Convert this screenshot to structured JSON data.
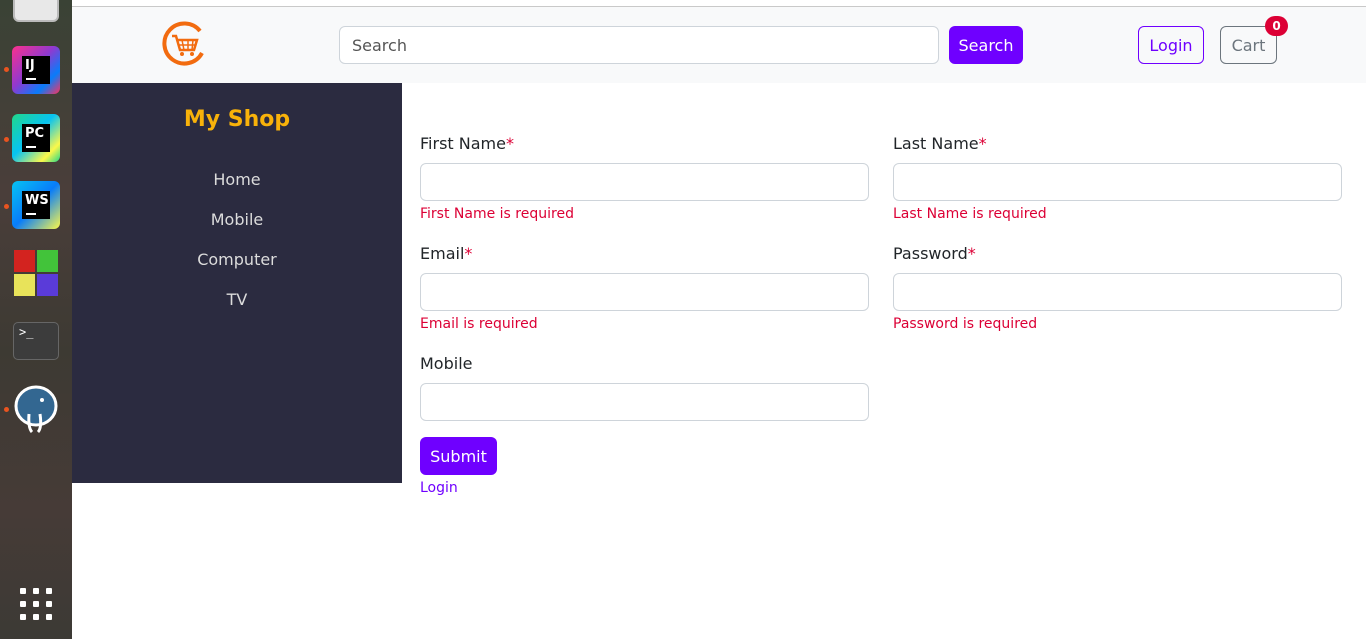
{
  "dock": {
    "apps": [
      {
        "name": "intellij-idea-icon",
        "label": "IJ"
      },
      {
        "name": "pycharm-icon",
        "label": "PC"
      },
      {
        "name": "webstorm-icon",
        "label": "WS"
      },
      {
        "name": "colored-squares-app-icon",
        "label": ""
      },
      {
        "name": "terminal-icon",
        "label": ">_"
      },
      {
        "name": "pgadmin-elephant-icon",
        "label": ""
      },
      {
        "name": "show-apps-grid-icon",
        "label": ""
      }
    ]
  },
  "navbar": {
    "search_placeholder": "Search",
    "search_button": "Search",
    "login_button": "Login",
    "cart_button": "Cart",
    "cart_count": "0"
  },
  "sidebar": {
    "brand": "My Shop",
    "items": [
      "Home",
      "Mobile",
      "Computer",
      "TV"
    ]
  },
  "form": {
    "first_name": {
      "label": "First Name",
      "required_mark": "*",
      "value": "",
      "error": "First Name is required"
    },
    "last_name": {
      "label": "Last Name",
      "required_mark": "*",
      "value": "",
      "error": "Last Name is required"
    },
    "email": {
      "label": "Email",
      "required_mark": "*",
      "value": "",
      "error": "Email is required"
    },
    "password": {
      "label": "Password",
      "required_mark": "*",
      "value": "",
      "error": "Password is required"
    },
    "mobile": {
      "label": "Mobile",
      "value": ""
    },
    "submit": "Submit",
    "login_link": "Login"
  },
  "colors": {
    "primary": "#6f00ff",
    "danger": "#dc0035",
    "sidebar_bg": "#2b2b40",
    "brand": "#f8b20a",
    "logo": "#f26b0f"
  }
}
